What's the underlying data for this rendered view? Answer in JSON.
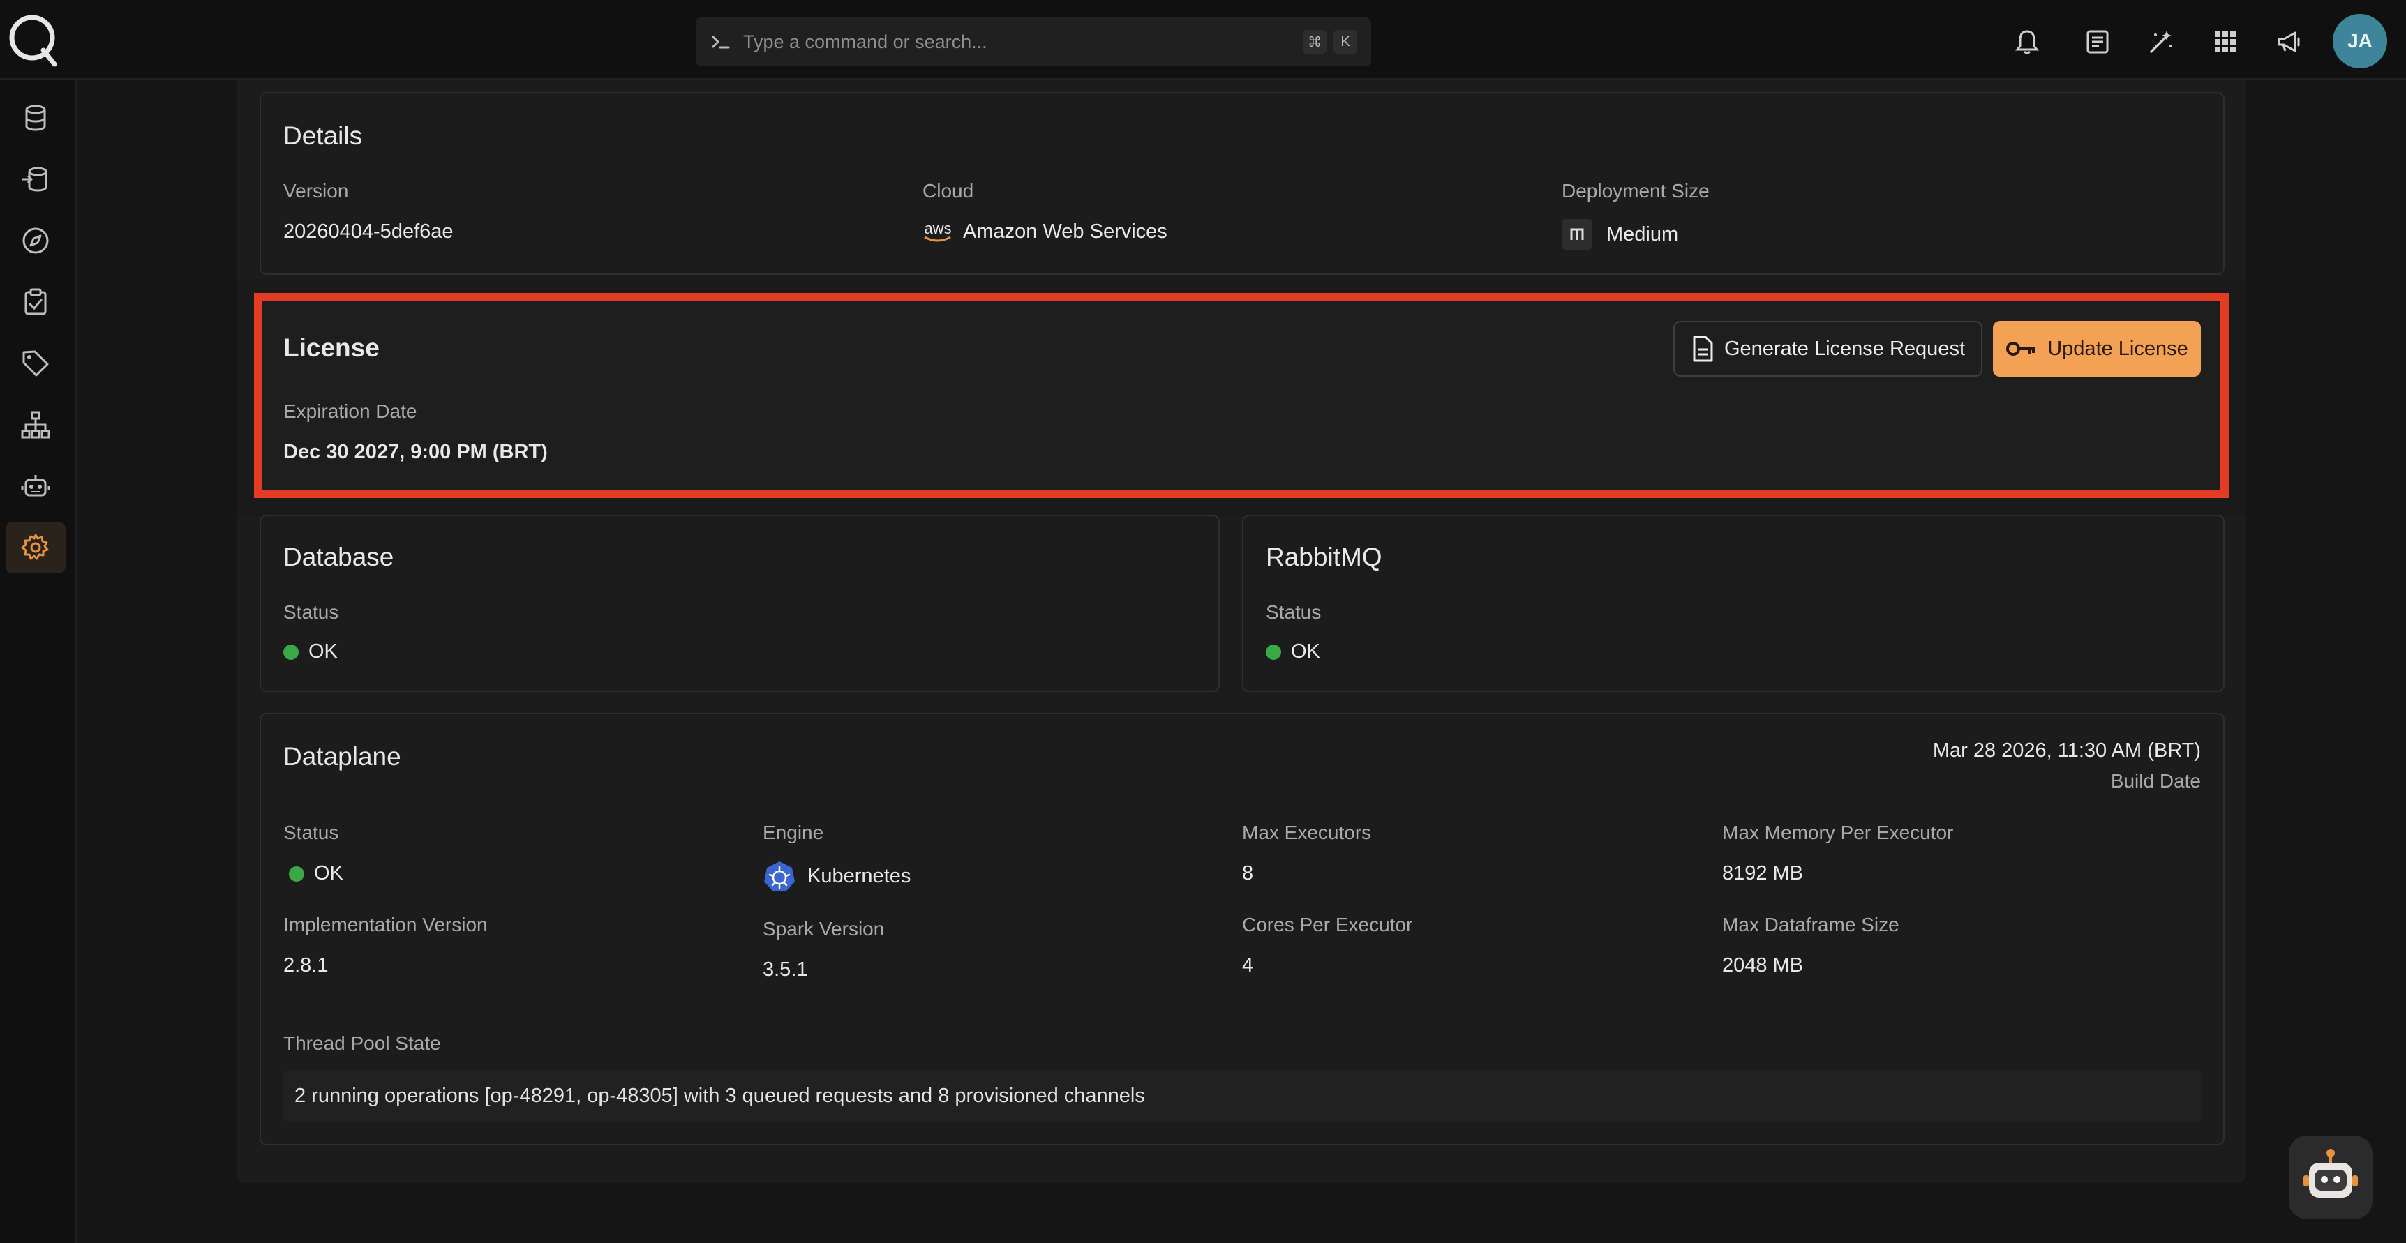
{
  "search": {
    "placeholder": "Type a command or search...",
    "kbd_cmd": "⌘",
    "kbd_k": "K"
  },
  "header": {
    "avatar_initials": "JA"
  },
  "details": {
    "title": "Details",
    "version_label": "Version",
    "version_value": "20260404-5def6ae",
    "cloud_label": "Cloud",
    "cloud_value": "Amazon Web Services",
    "cloud_logo_text": "aws",
    "deployment_label": "Deployment Size",
    "deployment_value": "Medium"
  },
  "license": {
    "title": "License",
    "expiration_label": "Expiration Date",
    "expiration_value": "Dec 30 2027, 9:00 PM (BRT)",
    "generate_button": "Generate License Request",
    "update_button": "Update License"
  },
  "database": {
    "title": "Database",
    "status_label": "Status",
    "status_value": "OK"
  },
  "rabbitmq": {
    "title": "RabbitMQ",
    "status_label": "Status",
    "status_value": "OK"
  },
  "dataplane": {
    "title": "Dataplane",
    "build_date_value": "Mar 28 2026, 11:30 AM (BRT)",
    "build_date_label": "Build Date",
    "status_label": "Status",
    "status_value": "OK",
    "engine_label": "Engine",
    "engine_value": "Kubernetes",
    "max_executors_label": "Max Executors",
    "max_executors_value": "8",
    "max_memory_label": "Max Memory Per Executor",
    "max_memory_value": "8192 MB",
    "impl_version_label": "Implementation Version",
    "impl_version_value": "2.8.1",
    "spark_version_label": "Spark Version",
    "spark_version_value": "3.5.1",
    "cores_label": "Cores Per Executor",
    "cores_value": "4",
    "max_df_label": "Max Dataframe Size",
    "max_df_value": "2048 MB",
    "thread_pool_label": "Thread Pool State",
    "thread_pool_value": "2 running operations [op-48291, op-48305] with 3 queued requests and 8 provisioned channels"
  },
  "colors": {
    "accent": "#f3a154",
    "highlight": "#e23c25",
    "status_ok": "#3aa845",
    "avatar": "#3f8599"
  },
  "icons": {
    "sidebar": [
      "database-icon",
      "datasets-icon",
      "compass-icon",
      "clipboard-check-icon",
      "tag-icon",
      "hierarchy-icon",
      "robot-icon",
      "gear-icon"
    ],
    "top": [
      "bell-icon",
      "document-icon",
      "magic-wand-icon",
      "apps-grid-icon",
      "megaphone-icon"
    ]
  }
}
